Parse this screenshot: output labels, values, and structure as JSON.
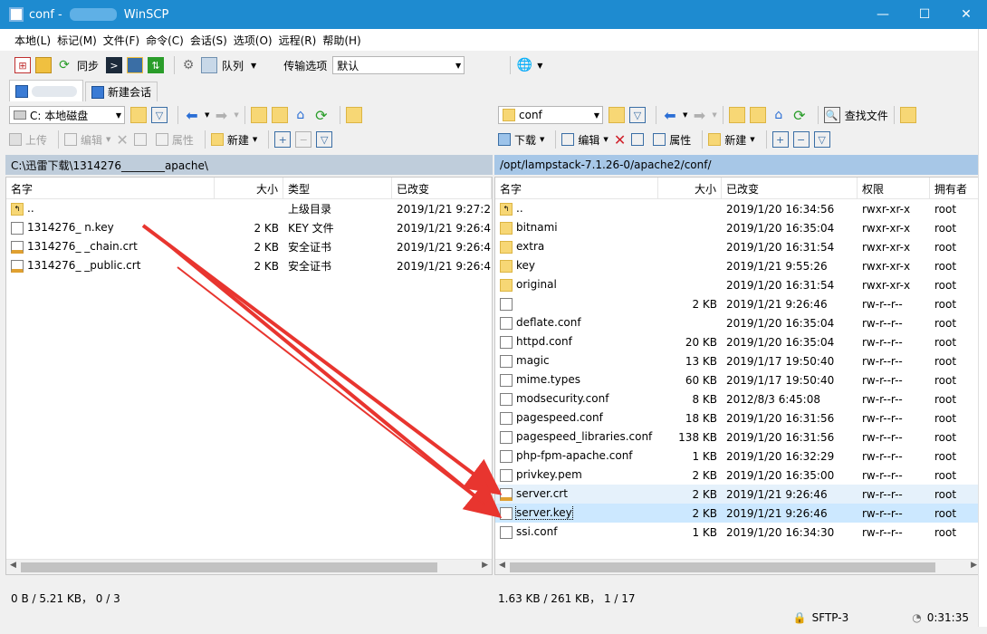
{
  "window": {
    "title_prefix": "conf -",
    "title_app": "WinSCP",
    "minimize": "—",
    "maximize": "☐",
    "close": "✕"
  },
  "menu": [
    "本地(L)",
    "标记(M)",
    "文件(F)",
    "命令(C)",
    "会话(S)",
    "选项(O)",
    "远程(R)",
    "帮助(H)"
  ],
  "toolbar": {
    "sync_label": "同步",
    "queue_label": "队列",
    "transfer_label": "传输选项",
    "transfer_value": "默认"
  },
  "tabs": {
    "new_session": "新建会话"
  },
  "left": {
    "drive": "C: 本地磁盘",
    "ops": {
      "upload": "上传",
      "edit": "编辑",
      "properties": "属性",
      "new": "新建"
    },
    "path": "C:\\迅雷下载\\1314276________apache\\",
    "columns": [
      "名字",
      "大小",
      "类型",
      "已改变"
    ],
    "files": [
      {
        "icon": "up",
        "name": "..",
        "size": "",
        "type": "上级目录",
        "modified": "2019/1/21  9:27:2"
      },
      {
        "icon": "key",
        "name": "1314276_         n.key",
        "size": "2 KB",
        "type": "KEY 文件",
        "modified": "2019/1/21  9:26:4"
      },
      {
        "icon": "cert",
        "name": "1314276_         _chain.crt",
        "size": "2 KB",
        "type": "安全证书",
        "modified": "2019/1/21  9:26:4"
      },
      {
        "icon": "cert",
        "name": "1314276_         _public.crt",
        "size": "2 KB",
        "type": "安全证书",
        "modified": "2019/1/21  9:26:4"
      }
    ],
    "status": "0 B / 5.21 KB，  0 / 3"
  },
  "right": {
    "folder": "conf",
    "find_files": "查找文件",
    "ops": {
      "download": "下载",
      "edit": "编辑",
      "properties": "属性",
      "new": "新建"
    },
    "path": "/opt/lampstack-7.1.26-0/apache2/conf/",
    "columns": [
      "名字",
      "大小",
      "已改变",
      "权限",
      "拥有者"
    ],
    "files": [
      {
        "icon": "up",
        "name": "..",
        "size": "",
        "modified": "2019/1/20  16:34:56",
        "perm": "rwxr-xr-x",
        "owner": "root"
      },
      {
        "icon": "folder",
        "name": "bitnami",
        "size": "",
        "modified": "2019/1/20  16:35:04",
        "perm": "rwxr-xr-x",
        "owner": "root"
      },
      {
        "icon": "folder",
        "name": "extra",
        "size": "",
        "modified": "2019/1/20  16:31:54",
        "perm": "rwxr-xr-x",
        "owner": "root"
      },
      {
        "icon": "folder",
        "name": "key",
        "size": "",
        "modified": "2019/1/21  9:55:26",
        "perm": "rwxr-xr-x",
        "owner": "root"
      },
      {
        "icon": "folder",
        "name": "original",
        "size": "",
        "modified": "2019/1/20  16:31:54",
        "perm": "rwxr-xr-x",
        "owner": "root"
      },
      {
        "icon": "doc",
        "name": "",
        "size": "2 KB",
        "modified": "2019/1/21  9:26:46",
        "perm": "rw-r--r--",
        "owner": "root"
      },
      {
        "icon": "doc",
        "name": "deflate.conf",
        "size": "",
        "modified": "2019/1/20  16:35:04",
        "perm": "rw-r--r--",
        "owner": "root"
      },
      {
        "icon": "doc",
        "name": "httpd.conf",
        "size": "20 KB",
        "modified": "2019/1/20  16:35:04",
        "perm": "rw-r--r--",
        "owner": "root"
      },
      {
        "icon": "doc",
        "name": "magic",
        "size": "13 KB",
        "modified": "2019/1/17  19:50:40",
        "perm": "rw-r--r--",
        "owner": "root"
      },
      {
        "icon": "doc",
        "name": "mime.types",
        "size": "60 KB",
        "modified": "2019/1/17  19:50:40",
        "perm": "rw-r--r--",
        "owner": "root"
      },
      {
        "icon": "doc",
        "name": "modsecurity.conf",
        "size": "8 KB",
        "modified": "2012/8/3  6:45:08",
        "perm": "rw-r--r--",
        "owner": "root"
      },
      {
        "icon": "doc",
        "name": "pagespeed.conf",
        "size": "18 KB",
        "modified": "2019/1/20  16:31:56",
        "perm": "rw-r--r--",
        "owner": "root"
      },
      {
        "icon": "doc",
        "name": "pagespeed_libraries.conf",
        "size": "138 KB",
        "modified": "2019/1/20  16:31:56",
        "perm": "rw-r--r--",
        "owner": "root"
      },
      {
        "icon": "doc",
        "name": "php-fpm-apache.conf",
        "size": "1 KB",
        "modified": "2019/1/20  16:32:29",
        "perm": "rw-r--r--",
        "owner": "root"
      },
      {
        "icon": "doc",
        "name": "privkey.pem",
        "size": "2 KB",
        "modified": "2019/1/20  16:35:00",
        "perm": "rw-r--r--",
        "owner": "root"
      },
      {
        "icon": "cert",
        "name": "server.crt",
        "size": "2 KB",
        "modified": "2019/1/21  9:26:46",
        "perm": "rw-r--r--",
        "owner": "root"
      },
      {
        "icon": "doc",
        "name": "server.key",
        "size": "2 KB",
        "modified": "2019/1/21  9:26:46",
        "perm": "rw-r--r--",
        "owner": "root"
      },
      {
        "icon": "doc",
        "name": "ssi.conf",
        "size": "1 KB",
        "modified": "2019/1/20  16:34:30",
        "perm": "rw-r--r--",
        "owner": "root"
      }
    ],
    "status": "1.63 KB / 261 KB，  1 / 17"
  },
  "bottom": {
    "protocol": "SFTP-3",
    "time": "0:31:35"
  },
  "colors": {
    "titlebar": "#1e8bd0",
    "path_active": "#a7c7e7",
    "arrow": "#e8352f"
  }
}
